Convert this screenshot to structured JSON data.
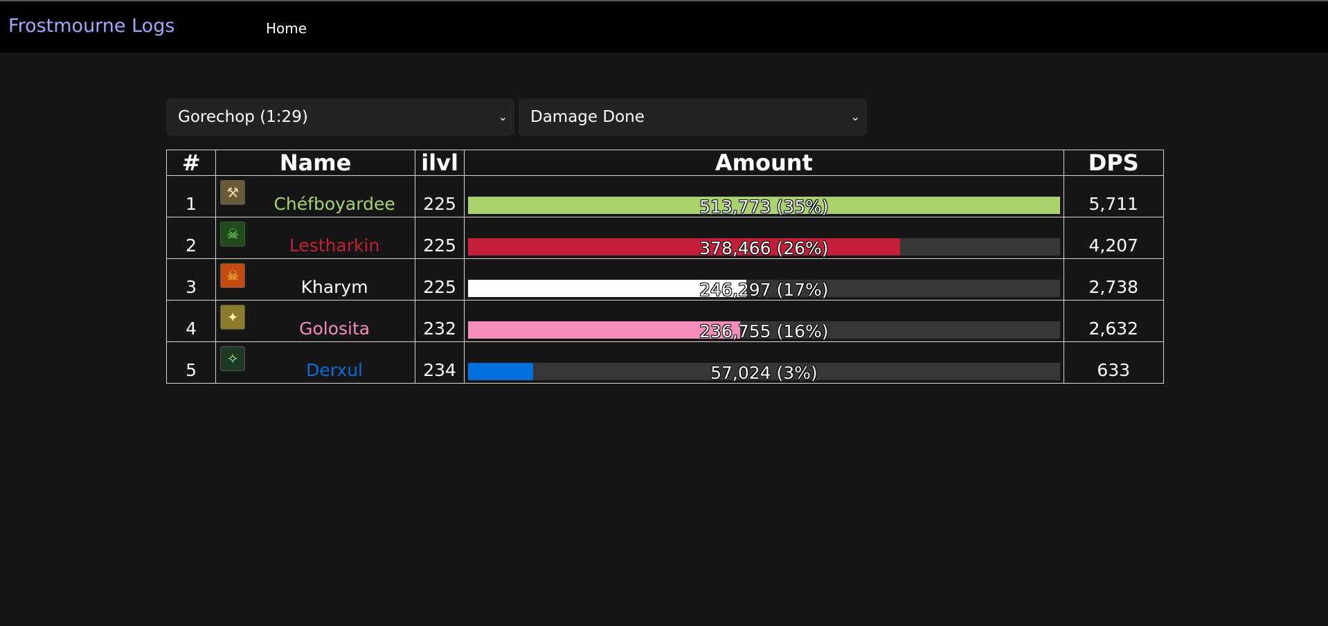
{
  "nav": {
    "brand": "Frostmourne Logs",
    "home_label": "Home"
  },
  "filters": {
    "encounter": "Gorechop (1:29)",
    "metric": "Damage Done"
  },
  "table": {
    "headers": {
      "rank": "#",
      "name": "Name",
      "ilvl": "ilvl",
      "amount": "Amount",
      "dps": "DPS"
    },
    "rows": [
      {
        "rank": "1",
        "name": "Chéfboyardee",
        "ilvl": "225",
        "amount": "513,773 (35%)",
        "dps": "5,711",
        "fill": 1.0,
        "color": "#a9d26e",
        "icon": "axe-icon"
      },
      {
        "rank": "2",
        "name": "Lestharkin",
        "ilvl": "225",
        "amount": "378,466 (26%)",
        "dps": "4,207",
        "fill": 0.73,
        "color": "#c41e3a",
        "icon": "skull-green-icon"
      },
      {
        "rank": "3",
        "name": "Kharym",
        "ilvl": "225",
        "amount": "246,297 (17%)",
        "dps": "2,738",
        "fill": 0.47,
        "color": "#ffffff",
        "icon": "skull-fire-icon"
      },
      {
        "rank": "4",
        "name": "Golosita",
        "ilvl": "232",
        "amount": "236,755 (16%)",
        "dps": "2,632",
        "fill": 0.46,
        "color": "#f48cba",
        "icon": "wings-icon"
      },
      {
        "rank": "5",
        "name": "Derxul",
        "ilvl": "234",
        "amount": "57,024 (3%)",
        "dps": "633",
        "fill": 0.11,
        "color": "#0070dd",
        "icon": "claw-icon"
      }
    ]
  },
  "colors": {
    "background": "#161616",
    "navbar": "#000000",
    "brand": "#a0a8ff",
    "bar_track": "#363636"
  }
}
